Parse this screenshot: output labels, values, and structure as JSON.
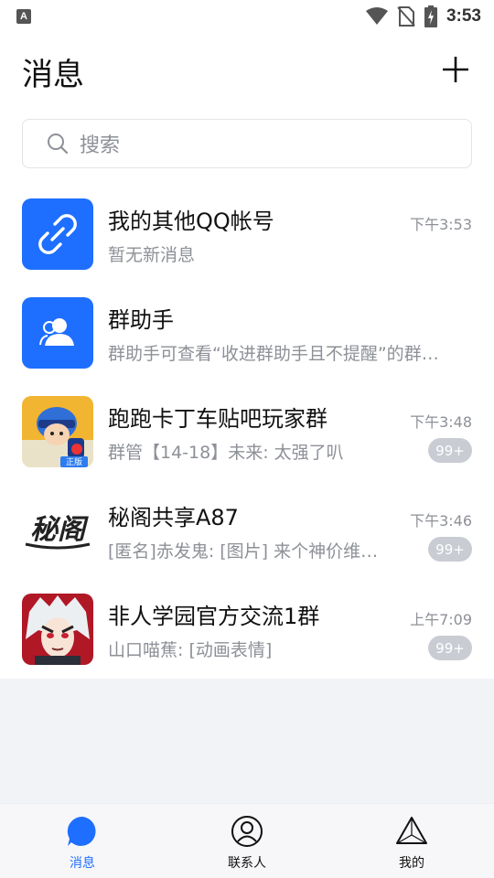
{
  "status_bar": {
    "time": "3:53",
    "indicator": "A"
  },
  "header": {
    "title": "消息"
  },
  "search": {
    "placeholder": "搜索"
  },
  "conversations": [
    {
      "name": "我的其他QQ帐号",
      "preview": "暂无新消息",
      "time": "下午3:53",
      "badge": ""
    },
    {
      "name": "群助手",
      "preview": "群助手可查看“收进群助手且不提醒”的群…",
      "time": "",
      "badge": ""
    },
    {
      "name": "跑跑卡丁车贴吧玩家群",
      "preview": "群管【14-18】未来: 太强了叭",
      "time": "下午3:48",
      "badge": "99+",
      "avatar_text": "正版"
    },
    {
      "name": "秘阁共享A87",
      "preview": "[匿名]赤发鬼: [图片] 来个神价维…",
      "time": "下午3:46",
      "badge": "99+",
      "avatar_text": "秘阁"
    },
    {
      "name": "非人学园官方交流1群",
      "preview": "山口喵蕉: [动画表情]",
      "time": "上午7:09",
      "badge": "99+"
    }
  ],
  "bottom_nav": [
    {
      "label": "消息",
      "active": true
    },
    {
      "label": "联系人",
      "active": false
    },
    {
      "label": "我的",
      "active": false
    }
  ],
  "colors": {
    "accent": "#1e6fff",
    "muted": "#8d9097",
    "badge": "#c9ccd3"
  }
}
